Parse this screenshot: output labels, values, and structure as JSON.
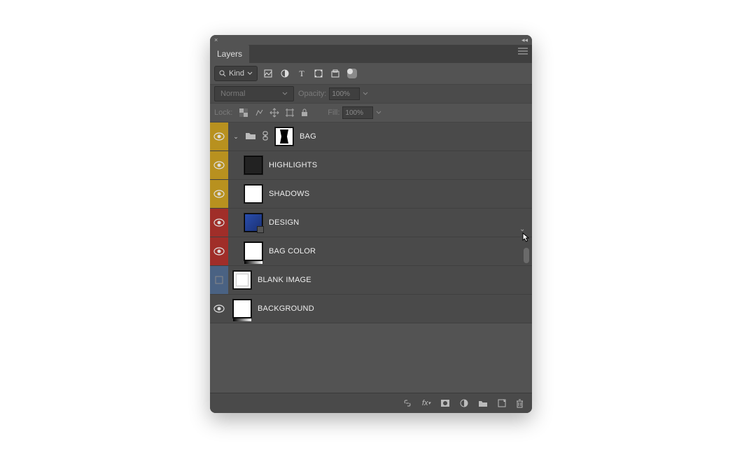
{
  "panel": {
    "title": "Layers",
    "filter": {
      "kind_label": "Kind",
      "icons": [
        "image-icon",
        "adjustment-icon",
        "type-icon",
        "shape-icon",
        "smartobject-icon"
      ]
    },
    "blend": {
      "mode": "Normal",
      "opacity_label": "Opacity:",
      "opacity_value": "100%"
    },
    "lock": {
      "label": "Lock:",
      "fill_label": "Fill:",
      "fill_value": "100%"
    },
    "layers": [
      {
        "name": "BAG",
        "visible": true,
        "color": "gold",
        "group": true,
        "linked": true,
        "mask": true,
        "indent": 0
      },
      {
        "name": "HIGHLIGHTS",
        "visible": true,
        "color": "gold",
        "thumb": "dark",
        "indent": 1
      },
      {
        "name": "SHADOWS",
        "visible": true,
        "color": "gold",
        "thumb": "white",
        "indent": 1
      },
      {
        "name": "DESIGN",
        "visible": true,
        "color": "red",
        "thumb": "blue",
        "smart": true,
        "indent": 1,
        "chevron": true
      },
      {
        "name": "BAG COLOR",
        "visible": true,
        "color": "red",
        "thumb": "adj",
        "indent": 1
      },
      {
        "name": "BLANK IMAGE",
        "visible": false,
        "color": "blue",
        "thumb": "img",
        "indent": 0
      },
      {
        "name": "BACKGROUND",
        "visible": true,
        "color": "grey",
        "thumb": "adj",
        "indent": 0
      }
    ],
    "footer_icons": [
      "link-icon",
      "fx-icon",
      "mask-icon",
      "adjustment-icon",
      "folder-icon",
      "newlayer-icon",
      "trash-icon"
    ]
  }
}
